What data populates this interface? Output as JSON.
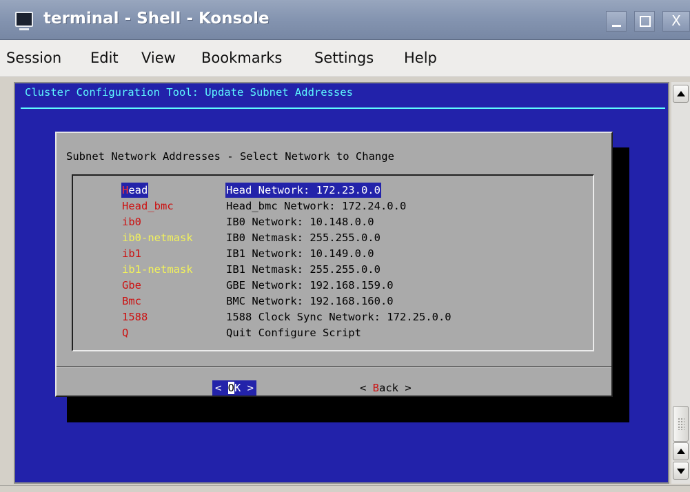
{
  "window": {
    "title": "terminal - Shell - Konsole",
    "icon": "terminal-icon",
    "controls": {
      "minimize": "minimize-icon",
      "maximize": "maximize-icon",
      "close": "X"
    }
  },
  "menubar": {
    "items": [
      "Session",
      "Edit",
      "View",
      "Bookmarks",
      "Settings",
      "Help"
    ]
  },
  "terminal": {
    "header": "Cluster Configuration Tool: Update Subnet Addresses",
    "dialog": {
      "title": "Subnet Network Addresses - Select Network to Change",
      "items": [
        {
          "tag": "Head",
          "desc": "Head Network: 172.23.0.0",
          "tag_color": "red",
          "selected": true
        },
        {
          "tag": "Head_bmc",
          "desc": "Head_bmc Network: 172.24.0.0",
          "tag_color": "red",
          "selected": false
        },
        {
          "tag": "ib0",
          "desc": "IB0 Network: 10.148.0.0",
          "tag_color": "red",
          "selected": false
        },
        {
          "tag": "ib0-netmask",
          "desc": "IB0 Netmask: 255.255.0.0",
          "tag_color": "yellow",
          "selected": false
        },
        {
          "tag": "ib1",
          "desc": "IB1 Network: 10.149.0.0",
          "tag_color": "red",
          "selected": false
        },
        {
          "tag": "ib1-netmask",
          "desc": "IB1 Netmask: 255.255.0.0",
          "tag_color": "yellow",
          "selected": false
        },
        {
          "tag": "Gbe",
          "desc": "GBE Network: 192.168.159.0",
          "tag_color": "red",
          "selected": false
        },
        {
          "tag": "Bmc",
          "desc": "BMC Network: 192.168.160.0",
          "tag_color": "red",
          "selected": false
        },
        {
          "tag": "1588",
          "desc": "1588 Clock Sync Network: 172.25.0.0",
          "tag_color": "red",
          "selected": false
        },
        {
          "tag": "Q",
          "desc": "Quit Configure Script",
          "tag_color": "red",
          "selected": false
        }
      ],
      "buttons": {
        "ok": {
          "left": "< ",
          "hot": "O",
          "rest": "K >"
        },
        "back": {
          "left": "< ",
          "hot": "B",
          "rest": "ack >"
        }
      }
    }
  },
  "colors": {
    "terminal_bg": "#2222aa",
    "header_text": "#5ffaff",
    "dialog_bg": "#aaaaaa",
    "selection_bg": "#2323aa",
    "tag_red": "#cc1111",
    "tag_yellow": "#f2f25a"
  }
}
